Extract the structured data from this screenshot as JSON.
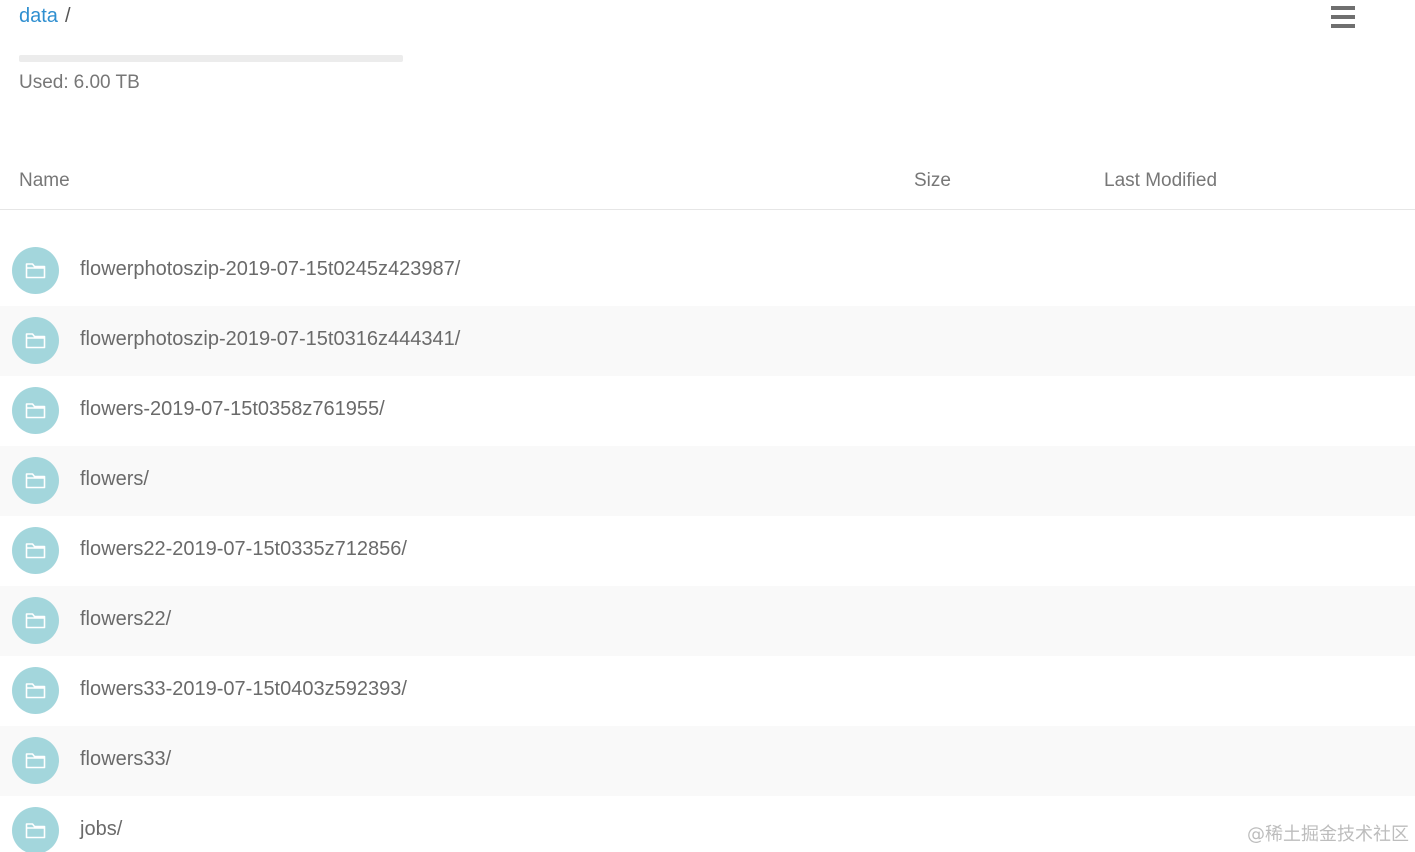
{
  "breadcrumb": {
    "root_label": "data",
    "separator": "/"
  },
  "menu": {
    "icon": "hamburger-icon"
  },
  "usage": {
    "label": "Used:",
    "value": "6.00 TB"
  },
  "table": {
    "columns": {
      "name": "Name",
      "size": "Size",
      "last_modified": "Last Modified"
    },
    "rows": [
      {
        "name": "flowerphotoszip-2019-07-15t0245z423987/",
        "icon": "folder-icon"
      },
      {
        "name": "flowerphotoszip-2019-07-15t0316z444341/",
        "icon": "folder-icon"
      },
      {
        "name": "flowers-2019-07-15t0358z761955/",
        "icon": "folder-icon"
      },
      {
        "name": "flowers/",
        "icon": "folder-icon"
      },
      {
        "name": "flowers22-2019-07-15t0335z712856/",
        "icon": "folder-icon"
      },
      {
        "name": "flowers22/",
        "icon": "folder-icon"
      },
      {
        "name": "flowers33-2019-07-15t0403z592393/",
        "icon": "folder-icon"
      },
      {
        "name": "flowers33/",
        "icon": "folder-icon"
      },
      {
        "name": "jobs/",
        "icon": "folder-icon"
      }
    ]
  },
  "watermark": "@稀土掘金技术社区",
  "colors": {
    "link": "#2f8fd0",
    "folder_circle": "#a3d6dc",
    "row_alt": "#f9f9f9"
  }
}
